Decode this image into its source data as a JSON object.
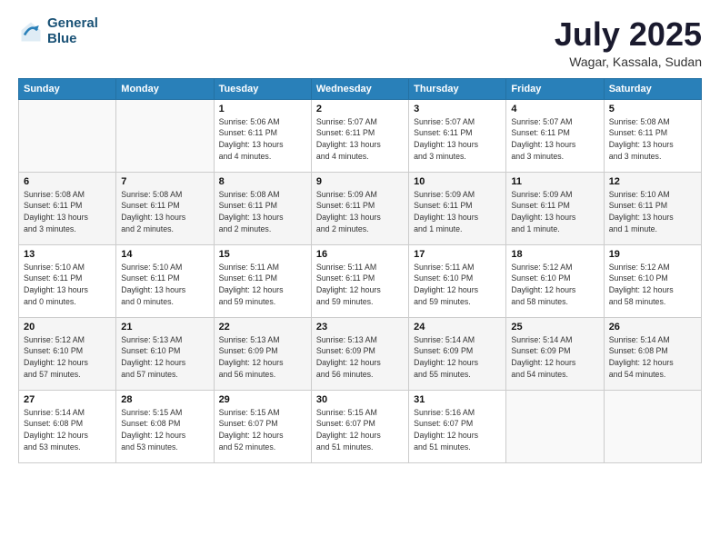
{
  "header": {
    "logo_line1": "General",
    "logo_line2": "Blue",
    "month": "July 2025",
    "location": "Wagar, Kassala, Sudan"
  },
  "weekdays": [
    "Sunday",
    "Monday",
    "Tuesday",
    "Wednesday",
    "Thursday",
    "Friday",
    "Saturday"
  ],
  "weeks": [
    [
      {
        "day": "",
        "detail": ""
      },
      {
        "day": "",
        "detail": ""
      },
      {
        "day": "1",
        "detail": "Sunrise: 5:06 AM\nSunset: 6:11 PM\nDaylight: 13 hours\nand 4 minutes."
      },
      {
        "day": "2",
        "detail": "Sunrise: 5:07 AM\nSunset: 6:11 PM\nDaylight: 13 hours\nand 4 minutes."
      },
      {
        "day": "3",
        "detail": "Sunrise: 5:07 AM\nSunset: 6:11 PM\nDaylight: 13 hours\nand 3 minutes."
      },
      {
        "day": "4",
        "detail": "Sunrise: 5:07 AM\nSunset: 6:11 PM\nDaylight: 13 hours\nand 3 minutes."
      },
      {
        "day": "5",
        "detail": "Sunrise: 5:08 AM\nSunset: 6:11 PM\nDaylight: 13 hours\nand 3 minutes."
      }
    ],
    [
      {
        "day": "6",
        "detail": "Sunrise: 5:08 AM\nSunset: 6:11 PM\nDaylight: 13 hours\nand 3 minutes."
      },
      {
        "day": "7",
        "detail": "Sunrise: 5:08 AM\nSunset: 6:11 PM\nDaylight: 13 hours\nand 2 minutes."
      },
      {
        "day": "8",
        "detail": "Sunrise: 5:08 AM\nSunset: 6:11 PM\nDaylight: 13 hours\nand 2 minutes."
      },
      {
        "day": "9",
        "detail": "Sunrise: 5:09 AM\nSunset: 6:11 PM\nDaylight: 13 hours\nand 2 minutes."
      },
      {
        "day": "10",
        "detail": "Sunrise: 5:09 AM\nSunset: 6:11 PM\nDaylight: 13 hours\nand 1 minute."
      },
      {
        "day": "11",
        "detail": "Sunrise: 5:09 AM\nSunset: 6:11 PM\nDaylight: 13 hours\nand 1 minute."
      },
      {
        "day": "12",
        "detail": "Sunrise: 5:10 AM\nSunset: 6:11 PM\nDaylight: 13 hours\nand 1 minute."
      }
    ],
    [
      {
        "day": "13",
        "detail": "Sunrise: 5:10 AM\nSunset: 6:11 PM\nDaylight: 13 hours\nand 0 minutes."
      },
      {
        "day": "14",
        "detail": "Sunrise: 5:10 AM\nSunset: 6:11 PM\nDaylight: 13 hours\nand 0 minutes."
      },
      {
        "day": "15",
        "detail": "Sunrise: 5:11 AM\nSunset: 6:11 PM\nDaylight: 12 hours\nand 59 minutes."
      },
      {
        "day": "16",
        "detail": "Sunrise: 5:11 AM\nSunset: 6:11 PM\nDaylight: 12 hours\nand 59 minutes."
      },
      {
        "day": "17",
        "detail": "Sunrise: 5:11 AM\nSunset: 6:10 PM\nDaylight: 12 hours\nand 59 minutes."
      },
      {
        "day": "18",
        "detail": "Sunrise: 5:12 AM\nSunset: 6:10 PM\nDaylight: 12 hours\nand 58 minutes."
      },
      {
        "day": "19",
        "detail": "Sunrise: 5:12 AM\nSunset: 6:10 PM\nDaylight: 12 hours\nand 58 minutes."
      }
    ],
    [
      {
        "day": "20",
        "detail": "Sunrise: 5:12 AM\nSunset: 6:10 PM\nDaylight: 12 hours\nand 57 minutes."
      },
      {
        "day": "21",
        "detail": "Sunrise: 5:13 AM\nSunset: 6:10 PM\nDaylight: 12 hours\nand 57 minutes."
      },
      {
        "day": "22",
        "detail": "Sunrise: 5:13 AM\nSunset: 6:09 PM\nDaylight: 12 hours\nand 56 minutes."
      },
      {
        "day": "23",
        "detail": "Sunrise: 5:13 AM\nSunset: 6:09 PM\nDaylight: 12 hours\nand 56 minutes."
      },
      {
        "day": "24",
        "detail": "Sunrise: 5:14 AM\nSunset: 6:09 PM\nDaylight: 12 hours\nand 55 minutes."
      },
      {
        "day": "25",
        "detail": "Sunrise: 5:14 AM\nSunset: 6:09 PM\nDaylight: 12 hours\nand 54 minutes."
      },
      {
        "day": "26",
        "detail": "Sunrise: 5:14 AM\nSunset: 6:08 PM\nDaylight: 12 hours\nand 54 minutes."
      }
    ],
    [
      {
        "day": "27",
        "detail": "Sunrise: 5:14 AM\nSunset: 6:08 PM\nDaylight: 12 hours\nand 53 minutes."
      },
      {
        "day": "28",
        "detail": "Sunrise: 5:15 AM\nSunset: 6:08 PM\nDaylight: 12 hours\nand 53 minutes."
      },
      {
        "day": "29",
        "detail": "Sunrise: 5:15 AM\nSunset: 6:07 PM\nDaylight: 12 hours\nand 52 minutes."
      },
      {
        "day": "30",
        "detail": "Sunrise: 5:15 AM\nSunset: 6:07 PM\nDaylight: 12 hours\nand 51 minutes."
      },
      {
        "day": "31",
        "detail": "Sunrise: 5:16 AM\nSunset: 6:07 PM\nDaylight: 12 hours\nand 51 minutes."
      },
      {
        "day": "",
        "detail": ""
      },
      {
        "day": "",
        "detail": ""
      }
    ]
  ]
}
